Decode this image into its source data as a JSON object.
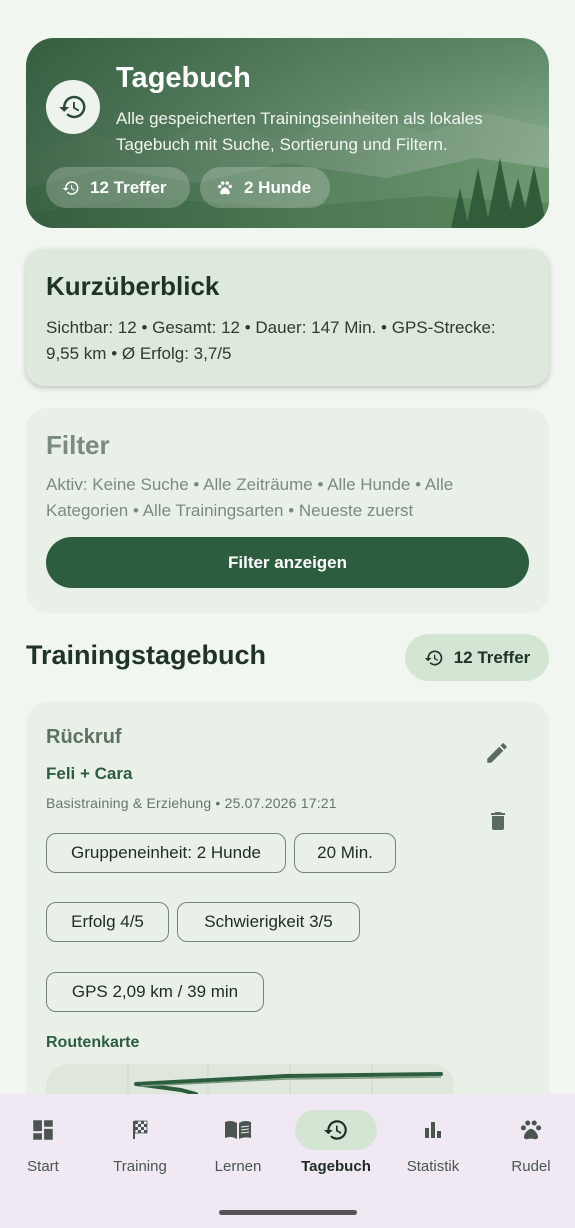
{
  "hero": {
    "title": "Tagebuch",
    "subtitle": "Alle gespeicherten Trainingseinheiten als lokales Tagebuch mit Suche, Sortierung und Filtern.",
    "chips": [
      {
        "icon": "history-icon",
        "label": "12 Treffer"
      },
      {
        "icon": "paw-icon",
        "label": "2 Hunde"
      }
    ]
  },
  "overview": {
    "title": "Kurzüberblick",
    "text": "Sichtbar: 12 • Gesamt: 12 • Dauer: 147 Min. • GPS-Strecke: 9,55 km • Ø Erfolg: 3,7/5"
  },
  "filter": {
    "title": "Filter",
    "text": "Aktiv: Keine Suche • Alle Zeiträume • Alle Hunde • Alle Kategorien • Alle Trainingsarten • Neueste zuerst",
    "button_label": "Filter anzeigen"
  },
  "section": {
    "title": "Trainingstagebuch",
    "count_label": "12 Treffer"
  },
  "entry": {
    "title": "Rückruf",
    "dogs": "Feli + Cara",
    "meta": "Basistraining & Erziehung • 25.07.2026 17:21",
    "tags": [
      "Gruppeneinheit: 2 Hunde",
      "20 Min.",
      "Erfolg 4/5",
      "Schwierigkeit 3/5",
      "GPS 2,09 km / 39 min"
    ],
    "route_label": "Routenkarte"
  },
  "nav": {
    "items": [
      {
        "label": "Start",
        "icon": "dashboard-icon"
      },
      {
        "label": "Training",
        "icon": "flag-icon"
      },
      {
        "label": "Lernen",
        "icon": "book-icon"
      },
      {
        "label": "Tagebuch",
        "icon": "history-icon",
        "active": true
      },
      {
        "label": "Statistik",
        "icon": "bar-chart-icon"
      },
      {
        "label": "Rudel",
        "icon": "paw-icon"
      }
    ]
  },
  "colors": {
    "primary": "#2d5d3f",
    "background": "#f2f6f1",
    "nav_background": "#f0e8f3",
    "active_pill": "#d4e6d3"
  }
}
